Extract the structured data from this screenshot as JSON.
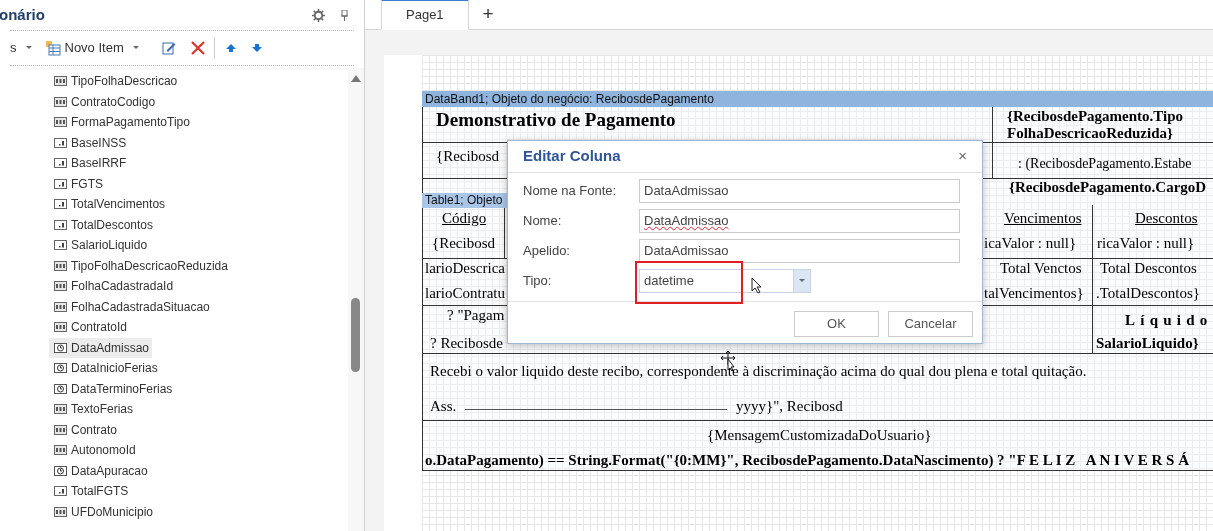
{
  "panel": {
    "title": "onário",
    "toolbar": [
      {
        "kind": "menu",
        "label": "s"
      },
      {
        "kind": "new",
        "label": "Novo Item"
      },
      {
        "kind": "edit"
      },
      {
        "kind": "delete"
      },
      {
        "kind": "up"
      },
      {
        "kind": "down"
      }
    ],
    "items": [
      {
        "label": "TipoFolhaDescricao",
        "kind": "text",
        "selected": false
      },
      {
        "label": "ContratoCodigo",
        "kind": "int",
        "selected": false
      },
      {
        "label": "FormaPagamentoTipo",
        "kind": "int",
        "selected": false
      },
      {
        "label": "BaseINSS",
        "kind": "decimal",
        "selected": false
      },
      {
        "label": "BaseIRRF",
        "kind": "decimal",
        "selected": false
      },
      {
        "label": "FGTS",
        "kind": "decimal",
        "selected": false
      },
      {
        "label": "TotalVencimentos",
        "kind": "decimal",
        "selected": false
      },
      {
        "label": "TotalDescontos",
        "kind": "decimal",
        "selected": false
      },
      {
        "label": "SalarioLiquido",
        "kind": "decimal",
        "selected": false
      },
      {
        "label": "TipoFolhaDescricaoReduzida",
        "kind": "text",
        "selected": false
      },
      {
        "label": "FolhaCadastradaId",
        "kind": "int",
        "selected": false
      },
      {
        "label": "FolhaCadastradaSituacao",
        "kind": "int",
        "selected": false
      },
      {
        "label": "ContratoId",
        "kind": "int",
        "selected": false
      },
      {
        "label": "DataAdmissao",
        "kind": "datetime",
        "selected": true
      },
      {
        "label": "DataInicioFerias",
        "kind": "datetime",
        "selected": false
      },
      {
        "label": "DataTerminoFerias",
        "kind": "datetime",
        "selected": false
      },
      {
        "label": "TextoFerias",
        "kind": "text",
        "selected": false
      },
      {
        "label": "Contrato",
        "kind": "int",
        "selected": false
      },
      {
        "label": "AutonomoId",
        "kind": "int",
        "selected": false
      },
      {
        "label": "DataApuracao",
        "kind": "datetime",
        "selected": false
      },
      {
        "label": "TotalFGTS",
        "kind": "decimal",
        "selected": false
      },
      {
        "label": "UFDoMunicipio",
        "kind": "text",
        "selected": false
      }
    ]
  },
  "tabs": [
    {
      "label": "Page1",
      "selected": true
    },
    {
      "label": "+",
      "selected": false
    }
  ],
  "report": {
    "bands": [
      "DataBand1; Objeto do negócio: RecibosdePagamento",
      "Table1; Objeto"
    ],
    "texts": [
      {
        "kind": "title",
        "text": "Demonstrativo de Pagamento"
      },
      {
        "kind": "bold",
        "text": "{RecibosdePagamento.Tipo"
      },
      {
        "kind": "bold",
        "text": "FolhaDescricaoReduzida}"
      },
      {
        "kind": "plain",
        "text": "{Recibosd"
      },
      {
        "kind": "small",
        "text": ": (RecibosdePagamento.Estabe"
      },
      {
        "kind": "bold",
        "text": "{RecibosdePagamento.CargoD"
      },
      {
        "kind": "heading",
        "text": "Código"
      },
      {
        "kind": "heading",
        "text": "Vencimentos"
      },
      {
        "kind": "heading",
        "text": "Descontos"
      },
      {
        "kind": "plain",
        "text": "{Recibosd"
      },
      {
        "kind": "plain",
        "text": "icaValor : null}"
      },
      {
        "kind": "plain",
        "text": "ricaValor : null}"
      },
      {
        "kind": "plain",
        "text": "larioDescrica"
      },
      {
        "kind": "plain",
        "text": "Total Venctos"
      },
      {
        "kind": "plain",
        "text": "Total Descontos"
      },
      {
        "kind": "plain",
        "text": "larioContratu"
      },
      {
        "kind": "plain",
        "text": "talVencimentos}"
      },
      {
        "kind": "plain",
        "text": ".TotalDescontos}"
      },
      {
        "kind": "plain",
        "text": "? \"Pagam"
      },
      {
        "kind": "plain",
        "text": "? Recibosde"
      },
      {
        "kind": "spaced",
        "text": "Líquido"
      },
      {
        "kind": "bold",
        "text": "SalarioLiquido}"
      },
      {
        "kind": "plain",
        "text": "Recebi o valor liquido deste recibo, correspondente à discriminação acima do qual dou plena e total quitação."
      },
      {
        "kind": "plain",
        "text": "Ass."
      },
      {
        "kind": "plain",
        "text": "yyyy}\", Recibosd"
      },
      {
        "kind": "plain",
        "text": "{MensagemCustomizadaDoUsuario}"
      },
      {
        "kind": "bold",
        "text": "o.DataPagamento) == String.Format(\"{0:MM}\", RecibosdePagamento.DataNascimento) ? \"F E L I Z   A N I V E R S Á"
      }
    ]
  },
  "dialog": {
    "title": "Editar Coluna",
    "close": "×",
    "fields": [
      {
        "label": "Nome na Fonte:",
        "value": "DataAdmissao",
        "misspelled": false
      },
      {
        "label": "Nome:",
        "value": "DataAdmissao",
        "misspelled": true
      },
      {
        "label": "Apelido:",
        "value": "DataAdmissao",
        "misspelled": false
      }
    ],
    "type": {
      "label": "Tipo:",
      "value": "datetime",
      "highlighted": true
    },
    "buttons": [
      "OK",
      "Cancelar"
    ]
  }
}
